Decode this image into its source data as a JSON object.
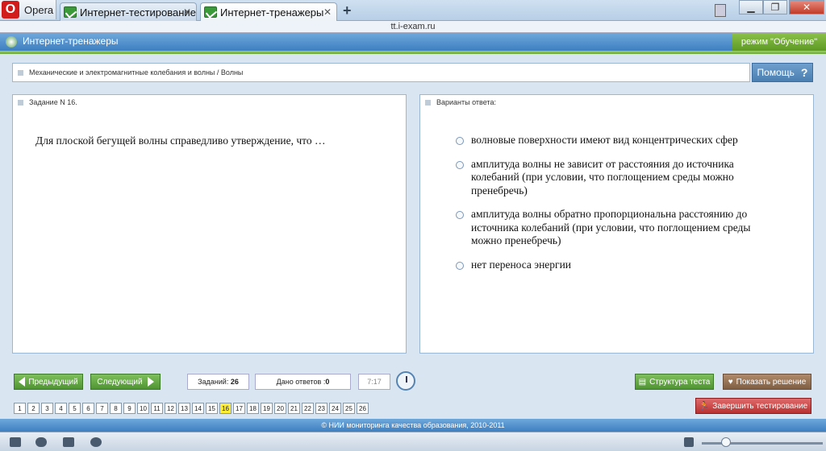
{
  "browser": {
    "menu_label": "Opera",
    "tabs": [
      {
        "label": "Интернет-тестирование",
        "active": false
      },
      {
        "label": "Интернет-тренажеры",
        "active": true
      }
    ],
    "address": "tt.i-exam.ru"
  },
  "app": {
    "title": "Интернет-тренажеры",
    "mode": "режим \"Обучение\"",
    "breadcrumb": "Механические и электромагнитные колебания и волны / Волны",
    "help_label": "Помощь",
    "help_glyph": "?"
  },
  "question": {
    "heading": "Задание N 16.",
    "text": "Для плоской бегущей волны справедливо утверждение, что …"
  },
  "answers": {
    "heading": "Варианты ответа:",
    "options": [
      "волновые поверхности имеют вид концентрических сфер",
      "амплитуда волны не зависит от расстояния до источника колебаний (при условии, что поглощением среды можно пренебречь)",
      "амплитуда волны обратно пропорциональна расстоянию до источника колебаний (при условии, что поглощением среды можно пренебречь)",
      "нет переноса энергии"
    ]
  },
  "controls": {
    "prev_label": "Предыдущий",
    "next_label": "Следующий",
    "tasks_label": "Заданий:",
    "tasks_value": "26",
    "answered_label": "Дано ответов :",
    "answered_value": "0",
    "timer": "7:17",
    "structure_label": "Структура теста",
    "show_solution_label": "Показать решение",
    "finish_label": "Завершить тестирование"
  },
  "pages": [
    "1",
    "2",
    "3",
    "4",
    "5",
    "6",
    "7",
    "8",
    "9",
    "10",
    "11",
    "12",
    "13",
    "14",
    "15",
    "16",
    "17",
    "18",
    "19",
    "20",
    "21",
    "22",
    "23",
    "24",
    "25",
    "26"
  ],
  "current_page": "16",
  "footer": "© НИИ мониторинга качества образования, 2010-2011"
}
